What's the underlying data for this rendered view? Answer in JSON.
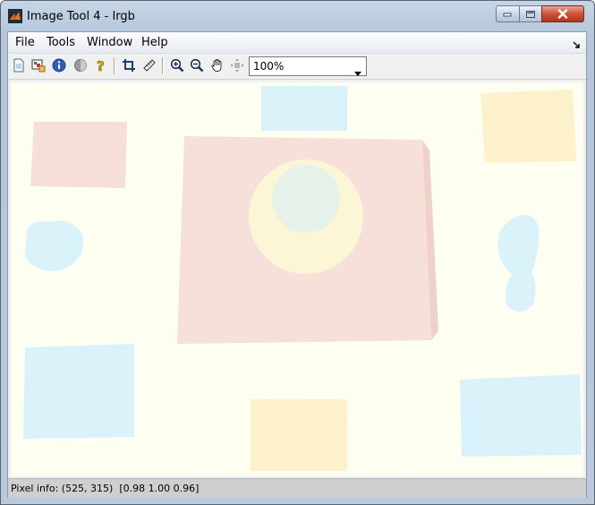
{
  "window": {
    "title": "Image Tool 4 - Irgb",
    "app_icon": "matlab-icon",
    "controls": [
      "minimize-icon",
      "maximize-icon",
      "close-icon"
    ]
  },
  "menubar": {
    "items": [
      {
        "label": "File"
      },
      {
        "label": "Tools"
      },
      {
        "label": "Window"
      },
      {
        "label": "Help"
      }
    ],
    "dock_icon": "dock-arrow-icon"
  },
  "toolbar": {
    "buttons": [
      {
        "icon": "new-figure-icon"
      },
      {
        "icon": "export-image-icon"
      },
      {
        "icon": "image-info-icon"
      },
      {
        "icon": "adjust-contrast-icon"
      },
      {
        "icon": "help-icon"
      },
      {
        "icon": "crop-icon"
      },
      {
        "icon": "measure-distance-icon"
      },
      {
        "icon": "zoom-in-icon"
      },
      {
        "icon": "zoom-out-icon"
      },
      {
        "icon": "pan-hand-icon"
      },
      {
        "icon": "overview-icon"
      }
    ],
    "zoom": {
      "value": "100%"
    }
  },
  "image": {
    "description_colors": {
      "background": "#fdfff1",
      "red_tint": "#f6dcd6",
      "cyan_tint": "#d6f1fb",
      "yellow_tint": "#fdf0c8"
    }
  },
  "status": {
    "pixel_info": "Pixel info: (525, 315)  [0.98 1.00 0.96]"
  },
  "colors": {
    "window_frame": "#b8cadd",
    "close_button": "#c95438",
    "statusbar": "#cfcfcf"
  }
}
